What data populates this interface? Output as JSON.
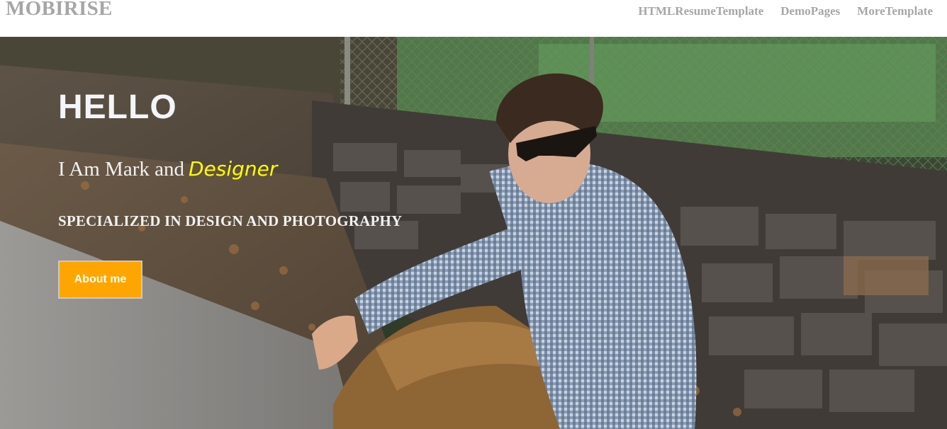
{
  "navbar": {
    "brand": "MOBIRISE",
    "links": [
      {
        "label": "HTMLResumeTemplate"
      },
      {
        "label": "DemoPages"
      },
      {
        "label": "MoreTemplate"
      }
    ]
  },
  "hero": {
    "heading": "HELLO",
    "intro_prefix": "I Am Mark and",
    "intro_role": "Designer",
    "tagline": "SPECIALIZED IN DESIGN AND PHOTOGRAPHY",
    "cta_label": "About me"
  },
  "colors": {
    "accent_button": "#ffa500",
    "role_highlight": "#ffff00",
    "nav_text": "#a6a6a6"
  }
}
